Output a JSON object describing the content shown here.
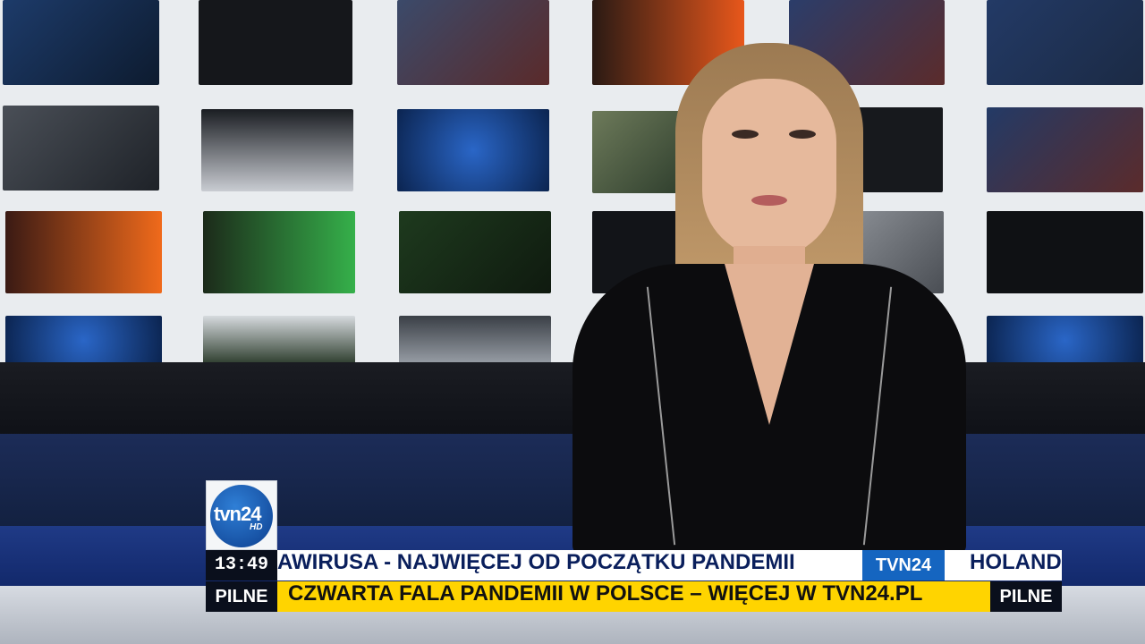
{
  "logo": {
    "text": "tvn24",
    "hd": "HD"
  },
  "clock": {
    "time": "13:49"
  },
  "ticker_top": {
    "headline": "AWIRUSA - NAJWIĘCEJ OD POCZĄTKU PANDEMII",
    "source_tag": "TVN24",
    "next_headline": "HOLAND"
  },
  "ticker_bottom": {
    "label_left": "PILNE",
    "headline": "CZWARTA FALA PANDEMII W POLSCE – WIĘCEJ W TVN24.PL",
    "label_right": "PILNE"
  },
  "colors": {
    "brand_blue": "#1565c0",
    "breaking_yellow": "#ffd400",
    "dark_navy": "#0a0f1c"
  }
}
